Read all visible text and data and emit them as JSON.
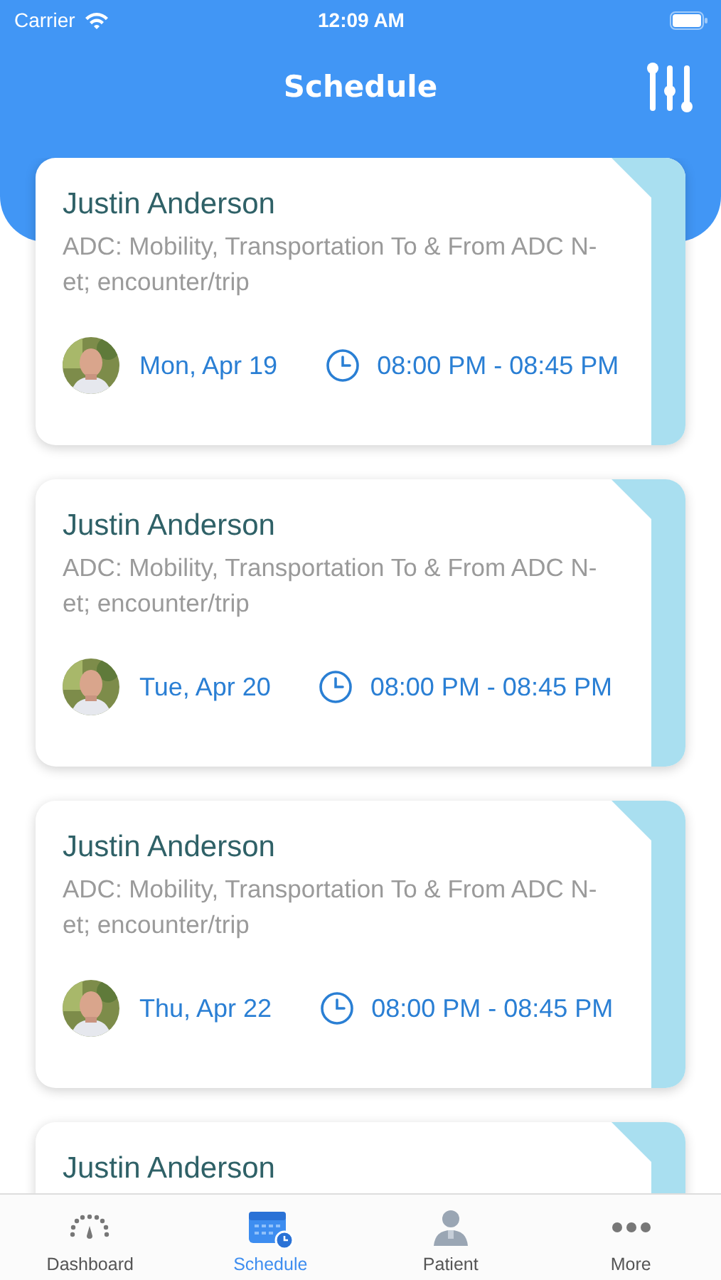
{
  "status_bar": {
    "carrier": "Carrier",
    "time": "12:09 AM"
  },
  "header": {
    "title": "Schedule"
  },
  "appointments": [
    {
      "name": "Justin Anderson",
      "service": "ADC: Mobility, Transportation To & From ADC N-et; encounter/trip",
      "date": "Mon, Apr 19",
      "time": "08:00 PM - 08:45 PM"
    },
    {
      "name": "Justin Anderson",
      "service": "ADC: Mobility, Transportation To & From ADC N-et; encounter/trip",
      "date": "Tue, Apr 20",
      "time": "08:00 PM - 08:45 PM"
    },
    {
      "name": "Justin Anderson",
      "service": "ADC: Mobility, Transportation To & From ADC N-et; encounter/trip",
      "date": "Thu, Apr 22",
      "time": "08:00 PM - 08:45 PM"
    },
    {
      "name": "Justin Anderson"
    }
  ],
  "tab_bar": [
    {
      "label": "Dashboard",
      "kind": "dashboard",
      "selected": false
    },
    {
      "label": "Schedule",
      "kind": "schedule",
      "selected": true
    },
    {
      "label": "Patient",
      "kind": "patient",
      "selected": false
    },
    {
      "label": "More",
      "kind": "more",
      "selected": false
    }
  ]
}
